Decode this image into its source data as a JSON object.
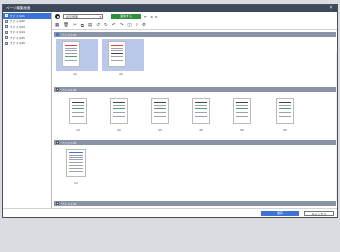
{
  "window": {
    "title": "ページ編集画面",
    "close_label": "×"
  },
  "sidebar": {
    "items": [
      {
        "label": "ファイル01",
        "selected": true
      },
      {
        "label": "ファイル02",
        "selected": false
      },
      {
        "label": "ファイル03",
        "selected": false
      },
      {
        "label": "ファイル04",
        "selected": false
      },
      {
        "label": "ファイル05",
        "selected": false
      },
      {
        "label": "ファイル06",
        "selected": false
      }
    ]
  },
  "toolbar1": {
    "select_value": "表示倍率",
    "green_button": "適用する",
    "nav_icons": [
      "page-first-icon",
      "prev-icon",
      "next-icon"
    ]
  },
  "toolbar2": {
    "icons": [
      "grid-icon",
      "delete-icon",
      "cut-icon",
      "copy-icon",
      "paste-icon",
      "rotate-left-icon",
      "rotate-right-icon",
      "undo-icon",
      "redo-icon",
      "fit-icon",
      "filter-icon",
      "settings-icon"
    ],
    "right_icon": "layout-icon"
  },
  "groups": [
    {
      "label": "ファイル01",
      "pages": [
        "1/2",
        "2/2"
      ]
    },
    {
      "label": "ファイル02",
      "pages": [
        "1/6",
        "2/6",
        "3/6",
        "4/6",
        "5/6",
        "6/6"
      ]
    },
    {
      "label": "ファイル03",
      "pages": [
        "1/1"
      ]
    },
    {
      "label": "ファイル04",
      "pages": []
    }
  ],
  "footer": {
    "ok_label": "保存",
    "cancel_label": "キャンセル"
  },
  "colors": {
    "accent": "#3b74d4",
    "green": "#2f8f3a",
    "titlebar": "#3c4a5c",
    "group_header": "#8a94a6"
  }
}
